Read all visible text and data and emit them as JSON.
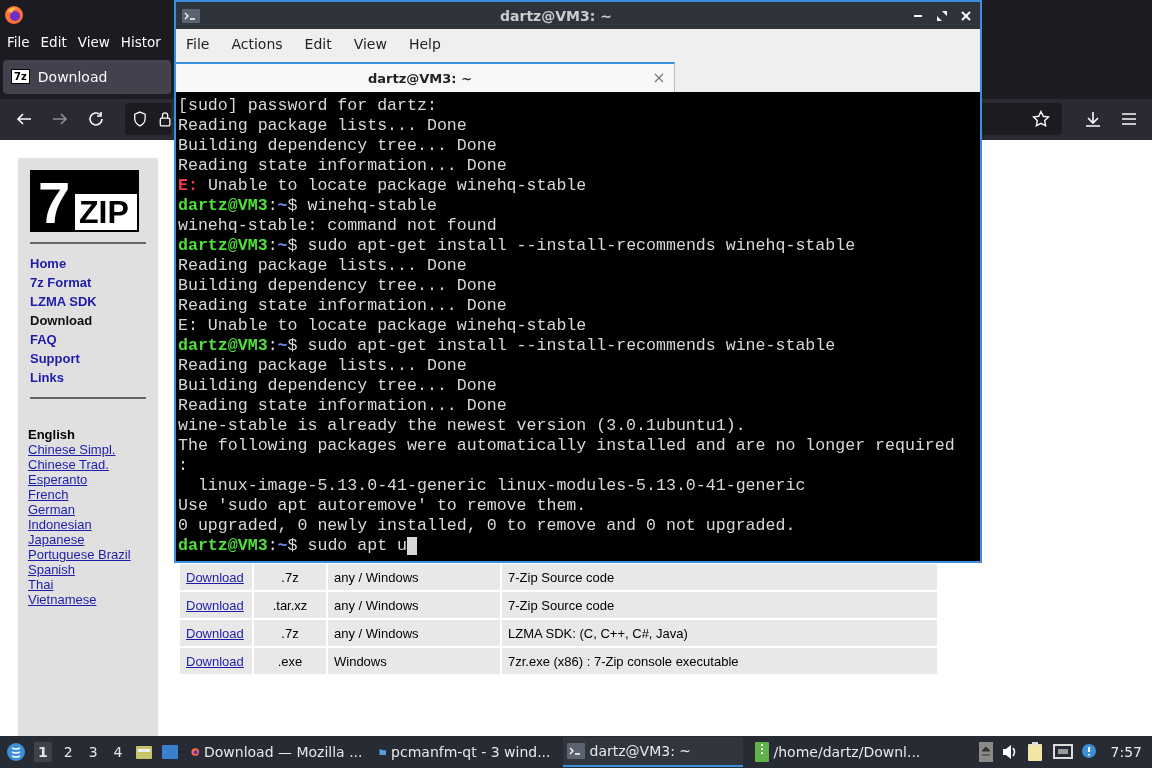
{
  "browser": {
    "menu": [
      "File",
      "Edit",
      "View",
      "Histor"
    ],
    "tab": {
      "title": "Download",
      "icon_text": "7z"
    },
    "logo": {
      "big": "7",
      "small": "ZIP"
    },
    "nav": [
      {
        "label": "Home",
        "selected": false
      },
      {
        "label": "7z Format",
        "selected": false
      },
      {
        "label": "LZMA SDK",
        "selected": false
      },
      {
        "label": "Download",
        "selected": true
      },
      {
        "label": "FAQ",
        "selected": false
      },
      {
        "label": "Support",
        "selected": false
      },
      {
        "label": "Links",
        "selected": false
      }
    ],
    "languages": [
      {
        "label": "English",
        "selected": true
      },
      {
        "label": "Chinese Simpl.",
        "selected": false
      },
      {
        "label": "Chinese Trad.",
        "selected": false
      },
      {
        "label": "Esperanto",
        "selected": false
      },
      {
        "label": "French",
        "selected": false
      },
      {
        "label": "German",
        "selected": false
      },
      {
        "label": "Indonesian",
        "selected": false
      },
      {
        "label": "Japanese",
        "selected": false
      },
      {
        "label": "Portuguese Brazil",
        "selected": false
      },
      {
        "label": "Spanish",
        "selected": false
      },
      {
        "label": "Thai",
        "selected": false
      },
      {
        "label": "Vietnamese",
        "selected": false
      }
    ],
    "table": {
      "rows": [
        {
          "link": "Download",
          "type": ".7z",
          "os": "any / Windows",
          "description": "7-Zip Source code"
        },
        {
          "link": "Download",
          "type": ".tar.xz",
          "os": "any / Windows",
          "description": "7-Zip Source code"
        },
        {
          "link": "Download",
          "type": ".7z",
          "os": "any / Windows",
          "description": "LZMA SDK: (C, C++, C#, Java)"
        },
        {
          "link": "Download",
          "type": ".exe",
          "os": "Windows",
          "description": "7zr.exe (x86) : 7-Zip console executable"
        }
      ]
    }
  },
  "terminal": {
    "title": "dartz@VM3: ~",
    "menu": [
      "File",
      "Actions",
      "Edit",
      "View",
      "Help"
    ],
    "tab": "dartz@VM3: ~",
    "cursor": true,
    "lines": [
      [
        {
          "kind": "plain",
          "text": "[sudo] password for dartz:"
        }
      ],
      [
        {
          "kind": "plain",
          "text": "Reading package lists... Done"
        }
      ],
      [
        {
          "kind": "plain",
          "text": "Building dependency tree... Done"
        }
      ],
      [
        {
          "kind": "plain",
          "text": "Reading state information... Done"
        }
      ],
      [
        {
          "kind": "error",
          "text": "E:"
        },
        {
          "kind": "plain",
          "text": " Unable to locate package winehq-stable"
        }
      ],
      [
        {
          "kind": "user",
          "text": "dartz@VM3"
        },
        {
          "kind": "plain",
          "text": ":"
        },
        {
          "kind": "path",
          "text": "~"
        },
        {
          "kind": "plain",
          "text": "$ winehq-stable"
        }
      ],
      [
        {
          "kind": "plain",
          "text": "winehq-stable: command not found"
        }
      ],
      [
        {
          "kind": "user",
          "text": "dartz@VM3"
        },
        {
          "kind": "plain",
          "text": ":"
        },
        {
          "kind": "path",
          "text": "~"
        },
        {
          "kind": "plain",
          "text": "$ sudo apt-get install --install-recommends winehq-stable"
        }
      ],
      [
        {
          "kind": "plain",
          "text": "Reading package lists... Done"
        }
      ],
      [
        {
          "kind": "plain",
          "text": "Building dependency tree... Done"
        }
      ],
      [
        {
          "kind": "plain",
          "text": "Reading state information... Done"
        }
      ],
      [
        {
          "kind": "plain",
          "text": "E: Unable to locate package winehq-stable"
        }
      ],
      [
        {
          "kind": "user",
          "text": "dartz@VM3"
        },
        {
          "kind": "plain",
          "text": ":"
        },
        {
          "kind": "path",
          "text": "~"
        },
        {
          "kind": "plain",
          "text": "$ sudo apt-get install --install-recommends wine-stable"
        }
      ],
      [
        {
          "kind": "plain",
          "text": "Reading package lists... Done"
        }
      ],
      [
        {
          "kind": "plain",
          "text": "Building dependency tree... Done"
        }
      ],
      [
        {
          "kind": "plain",
          "text": "Reading state information... Done"
        }
      ],
      [
        {
          "kind": "plain",
          "text": "wine-stable is already the newest version (3.0.1ubuntu1)."
        }
      ],
      [
        {
          "kind": "plain",
          "text": "The following packages were automatically installed and are no longer required"
        }
      ],
      [
        {
          "kind": "plain",
          "text": ":"
        }
      ],
      [
        {
          "kind": "plain",
          "text": "  linux-image-5.13.0-41-generic linux-modules-5.13.0-41-generic"
        }
      ],
      [
        {
          "kind": "plain",
          "text": "Use 'sudo apt autoremove' to remove them."
        }
      ],
      [
        {
          "kind": "plain",
          "text": "0 upgraded, 0 newly installed, 0 to remove and 0 not upgraded."
        }
      ],
      [
        {
          "kind": "user",
          "text": "dartz@VM3"
        },
        {
          "kind": "plain",
          "text": ":"
        },
        {
          "kind": "path",
          "text": "~"
        },
        {
          "kind": "plain",
          "text": "$ sudo apt u"
        }
      ]
    ]
  },
  "taskbar": {
    "desktops": [
      {
        "label": "1",
        "selected": true
      },
      {
        "label": "2",
        "selected": false
      },
      {
        "label": "3",
        "selected": false
      },
      {
        "label": "4",
        "selected": false
      }
    ],
    "tasks": [
      {
        "kind": "browser",
        "label": "Download — Mozilla ...",
        "selected": false
      },
      {
        "kind": "folder",
        "label": "pcmanfm-qt - 3 wind...",
        "selected": false
      },
      {
        "kind": "terminal",
        "label": "dartz@VM3: ~",
        "selected": true
      },
      {
        "kind": "archive",
        "label": "/home/dartz/Downl...",
        "selected": false
      }
    ],
    "clock": "7:57"
  }
}
